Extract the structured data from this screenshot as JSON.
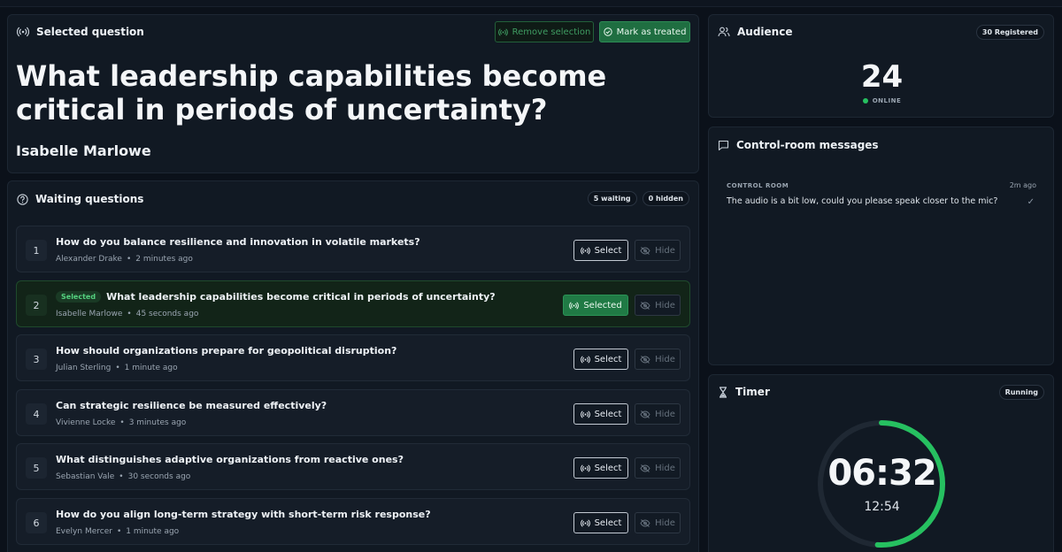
{
  "selected": {
    "heading": "Selected question",
    "remove_label": "Remove selection",
    "mark_label": "Mark as treated",
    "question": "What leadership capabilities become critical in periods of uncertainty?",
    "author": "Isabelle Marlowe"
  },
  "waiting": {
    "heading": "Waiting questions",
    "waiting_count": "5 waiting",
    "hidden_count": "0 hidden",
    "select_label": "Select",
    "selected_label": "Selected",
    "hide_label": "Hide",
    "selected_tag": "Selected",
    "questions": [
      {
        "num": "1",
        "text": "How do you balance resilience and innovation in volatile markets?",
        "author": "Alexander Drake",
        "time": "2 minutes ago",
        "selected": false
      },
      {
        "num": "2",
        "text": "What leadership capabilities become critical in periods of uncertainty?",
        "author": "Isabelle Marlowe",
        "time": "45 seconds ago",
        "selected": true
      },
      {
        "num": "3",
        "text": "How should organizations prepare for geopolitical disruption?",
        "author": "Julian Sterling",
        "time": "1 minute ago",
        "selected": false
      },
      {
        "num": "4",
        "text": "Can strategic resilience be measured effectively?",
        "author": "Vivienne Locke",
        "time": "3 minutes ago",
        "selected": false
      },
      {
        "num": "5",
        "text": "What distinguishes adaptive organizations from reactive ones?",
        "author": "Sebastian Vale",
        "time": "30 seconds ago",
        "selected": false
      },
      {
        "num": "6",
        "text": "How do you align long-term strategy with short-term risk response?",
        "author": "Evelyn Mercer",
        "time": "1 minute ago",
        "selected": false
      }
    ]
  },
  "audience": {
    "heading": "Audience",
    "registered": "30 Registered",
    "online_count": "24",
    "online_label": "ONLINE"
  },
  "messages": {
    "heading": "Control-room messages",
    "items": [
      {
        "from": "CONTROL ROOM",
        "time": "2m ago",
        "text": "The audio is a bit low, could you please speak closer to the mic?"
      }
    ]
  },
  "timer": {
    "heading": "Timer",
    "status": "Running",
    "remaining": "06:32",
    "total": "12:54",
    "progress_fraction": 0.51
  },
  "colors": {
    "accent_green": "#26c060",
    "background": "#0b111a"
  }
}
